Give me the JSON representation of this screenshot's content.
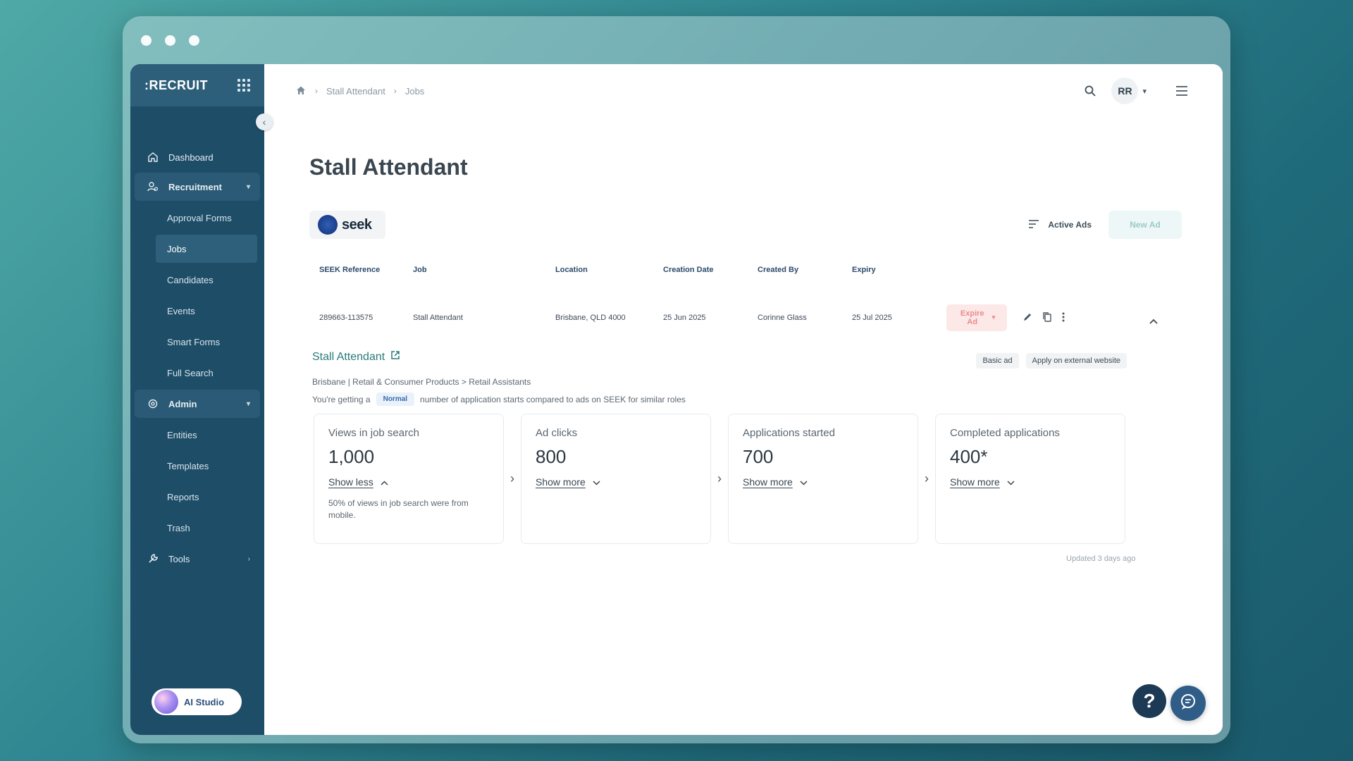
{
  "sidebar": {
    "logo": ":RECRUIT",
    "items": {
      "dashboard": "Dashboard",
      "recruitment": "Recruitment",
      "admin": "Admin",
      "tools": "Tools"
    },
    "recruitment_sub": [
      "Approval Forms",
      "Jobs",
      "Candidates",
      "Events",
      "Smart Forms",
      "Full Search"
    ],
    "admin_sub": [
      "Entities",
      "Templates",
      "Reports",
      "Trash"
    ],
    "ai_studio": "AI Studio"
  },
  "breadcrumb": [
    "Stall Attendant",
    "Jobs"
  ],
  "user": {
    "initials": "RR"
  },
  "page": {
    "title": "Stall Attendant"
  },
  "seek": {
    "logo_text": "seek"
  },
  "ads": {
    "active_ads_label": "Active Ads",
    "new_ad_label": "New Ad"
  },
  "table": {
    "headers": [
      "SEEK Reference",
      "Job",
      "Location",
      "Creation Date",
      "Created By",
      "Expiry"
    ],
    "row": [
      "289663-113575",
      "Stall Attendant",
      "Brisbane, QLD 4000",
      "25 Jun 2025",
      "Corinne Glass",
      "25 Jul 2025"
    ],
    "expire_label": "Expire Ad"
  },
  "ad": {
    "title": "Stall Attendant",
    "tags": [
      "Basic ad",
      "Apply on external website"
    ],
    "meta": "Brisbane | Retail & Consumer Products > Retail Assistants",
    "compare_prefix": "You're getting a",
    "compare_badge": "Normal",
    "compare_suffix": "number of application starts compared to ads on SEEK for similar roles"
  },
  "stats": [
    {
      "label": "Views in job search",
      "value": "1,000",
      "toggle": "Show less",
      "detail": "50% of views in job search were from mobile."
    },
    {
      "label": "Ad clicks",
      "value": "800",
      "toggle": "Show more"
    },
    {
      "label": "Applications started",
      "value": "700",
      "toggle": "Show more"
    },
    {
      "label": "Completed applications",
      "value": "400*",
      "toggle": "Show more"
    }
  ],
  "updated": "Updated 3 days ago",
  "help_label": "?"
}
